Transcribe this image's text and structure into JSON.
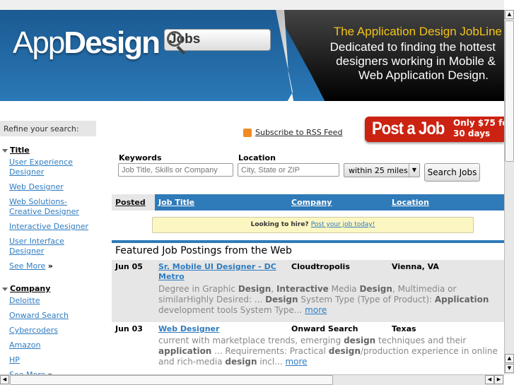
{
  "banner": {
    "logo_light": "App",
    "logo_bold": "Design",
    "logo_jobs": "Jobs",
    "tagline_title": "The Application Design JobLine",
    "tagline_lines": [
      "Dedicated to finding the hottest",
      "designers working in Mobile &",
      "Web Application Design."
    ],
    "tagline_color": "#f2c318"
  },
  "sidebar": {
    "refine_label": "Refine your search:",
    "facets": [
      {
        "heading": "Title",
        "items": [
          "User Experience Designer",
          "Web Designer",
          "Web Solutions-Creative Designer",
          "Interactive Designer",
          "User Interface Designer"
        ],
        "see_more": "See More",
        "see_more_icon": "»"
      },
      {
        "heading": "Company",
        "items": [
          "Deloitte",
          "Onward Search",
          "Cybercoders",
          "Amazon",
          "HP"
        ],
        "see_more": "See More",
        "see_more_icon": "»"
      }
    ]
  },
  "rss": {
    "label": "Subscribe to RSS Feed",
    "icon": "rss-icon"
  },
  "post_job": {
    "big": "Post a Job",
    "line1": "Only $75 fo",
    "line2": "30 days",
    "color": "#cc2211"
  },
  "search": {
    "keywords_label": "Keywords",
    "keywords_placeholder": "Job Title, Skills or Company",
    "location_label": "Location",
    "location_placeholder": "City, State or ZIP",
    "radius": "within 25 miles",
    "button": "Search Jobs"
  },
  "table": {
    "headers": [
      "Posted",
      "Job Title",
      "Company",
      "Location"
    ],
    "hire_text": "Looking to hire?",
    "hire_link": "Post your job today!",
    "featured_heading": "Featured Job Postings from the Web",
    "more_label": "more",
    "rows": [
      {
        "date": "Jun 05",
        "title": "Sr. Mobile UI Designer - DC Metro",
        "company": "Cloudtropolis",
        "location": "Vienna, VA",
        "snippet": [
          {
            "t": "Degree in Graphic "
          },
          {
            "t": "Design",
            "b": true
          },
          {
            "t": ", "
          },
          {
            "t": "Interactive",
            "b": true
          },
          {
            "t": " Media "
          },
          {
            "t": "Design",
            "b": true
          },
          {
            "t": ", Multimedia or similarHighly Desired: ... "
          },
          {
            "t": "Design",
            "b": true
          },
          {
            "t": " System Type (Type of Product): "
          },
          {
            "t": "Application",
            "b": true
          },
          {
            "t": " development tools System Type... "
          }
        ]
      },
      {
        "date": "Jun 03",
        "title": "Web Designer",
        "company": "Onward Search",
        "location": "Texas",
        "snippet": [
          {
            "t": "current with marketplace trends, emerging "
          },
          {
            "t": "design",
            "b": true
          },
          {
            "t": " techniques and their "
          },
          {
            "t": "application",
            "b": true
          },
          {
            "t": " ... Requirements: Practical "
          },
          {
            "t": "design",
            "b": true
          },
          {
            "t": "/production experience in online and rich-media "
          },
          {
            "t": "design",
            "b": true
          },
          {
            "t": " incl... "
          }
        ]
      }
    ]
  }
}
